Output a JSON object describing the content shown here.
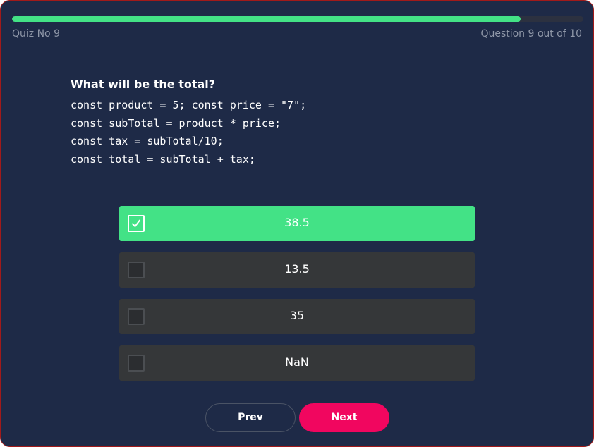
{
  "header": {
    "quiz_label": "Quiz No 9",
    "question_counter": "Question 9 out of 10",
    "progress": 0.89
  },
  "question": {
    "title": "What will be the total?",
    "code_lines": [
      "const product = 5; const price = \"7\";",
      "const subTotal = product * price;",
      "const tax = subTotal/10;",
      "const total = subTotal + tax;"
    ]
  },
  "options": [
    {
      "label": "38.5",
      "selected": true
    },
    {
      "label": "13.5",
      "selected": false
    },
    {
      "label": "35",
      "selected": false
    },
    {
      "label": "NaN",
      "selected": false
    }
  ],
  "nav": {
    "prev_label": "Prev",
    "next_label": "Next"
  },
  "colors": {
    "background": "#1e2a47",
    "accent_green": "#43e286",
    "accent_pink": "#f1065f",
    "option_bg": "#353739"
  },
  "icons": {
    "checkbox_checked": "check-icon"
  }
}
